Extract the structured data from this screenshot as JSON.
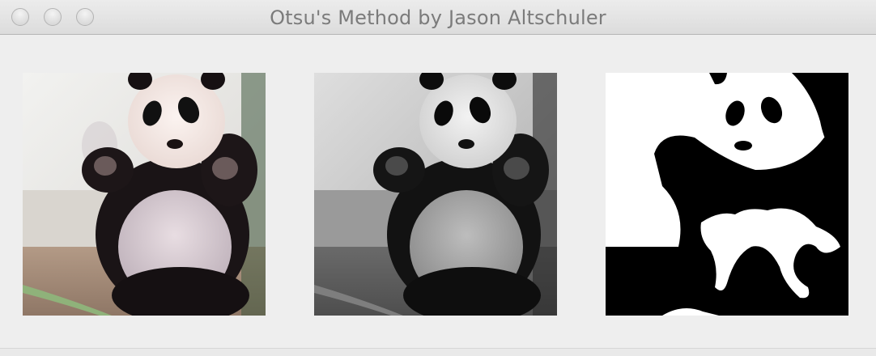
{
  "window": {
    "title": "Otsu's Method by Jason Altschuler"
  },
  "images": [
    {
      "name": "original",
      "type": "color-photo",
      "subject": "panda"
    },
    {
      "name": "grayscale",
      "type": "grayscale-photo",
      "subject": "panda"
    },
    {
      "name": "otsu-threshold",
      "type": "binary-image",
      "subject": "panda"
    }
  ],
  "colors": {
    "window_bg": "#eeeeee",
    "title_text": "#7b7b7b"
  }
}
